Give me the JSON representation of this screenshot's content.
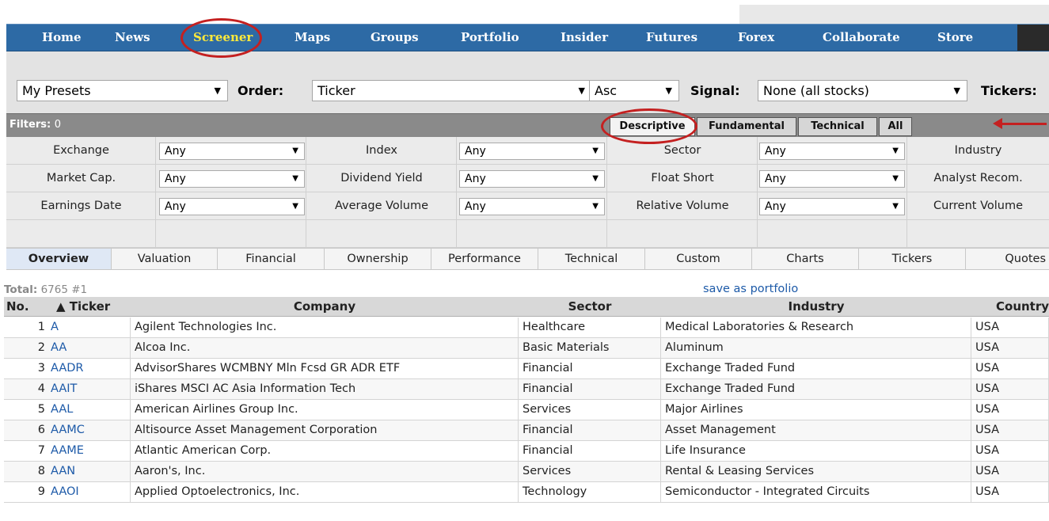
{
  "nav": {
    "items": [
      "Home",
      "News",
      "Screener",
      "Maps",
      "Groups",
      "Portfolio",
      "Insider",
      "Futures",
      "Forex",
      "Collaborate",
      "Store"
    ],
    "active": "Screener"
  },
  "toolbar": {
    "presets_value": "My Presets",
    "order_label": "Order:",
    "order_value": "Ticker",
    "direction_value": "Asc",
    "signal_label": "Signal:",
    "signal_value": "None (all stocks)",
    "tickers_label": "Tickers:"
  },
  "filters": {
    "label": "Filters:",
    "count": "0",
    "tabs": [
      "Descriptive",
      "Fundamental",
      "Technical",
      "All"
    ],
    "active_tab": "Descriptive",
    "rows": [
      [
        {
          "label": "Exchange",
          "value": "Any"
        },
        {
          "label": "Index",
          "value": "Any"
        },
        {
          "label": "Sector",
          "value": "Any"
        },
        {
          "label": "Industry",
          "value": ""
        }
      ],
      [
        {
          "label": "Market Cap.",
          "value": "Any"
        },
        {
          "label": "Dividend Yield",
          "value": "Any"
        },
        {
          "label": "Float Short",
          "value": "Any"
        },
        {
          "label": "Analyst Recom.",
          "value": ""
        }
      ],
      [
        {
          "label": "Earnings Date",
          "value": "Any"
        },
        {
          "label": "Average Volume",
          "value": "Any"
        },
        {
          "label": "Relative Volume",
          "value": "Any"
        },
        {
          "label": "Current Volume",
          "value": ""
        }
      ]
    ]
  },
  "view_tabs": [
    "Overview",
    "Valuation",
    "Financial",
    "Ownership",
    "Performance",
    "Technical",
    "Custom",
    "Charts",
    "Tickers",
    "Quotes"
  ],
  "active_view": "Overview",
  "total": {
    "label": "Total:",
    "value": "6765 #1"
  },
  "save_link": "save as portfolio",
  "table": {
    "headers": [
      "No.",
      "▲ Ticker",
      "Company",
      "Sector",
      "Industry",
      "Country"
    ],
    "rows": [
      [
        "1",
        "A",
        "Agilent Technologies Inc.",
        "Healthcare",
        "Medical Laboratories & Research",
        "USA"
      ],
      [
        "2",
        "AA",
        "Alcoa Inc.",
        "Basic Materials",
        "Aluminum",
        "USA"
      ],
      [
        "3",
        "AADR",
        "AdvisorShares WCMBNY Mln Fcsd GR ADR ETF",
        "Financial",
        "Exchange Traded Fund",
        "USA"
      ],
      [
        "4",
        "AAIT",
        "iShares MSCI AC Asia Information Tech",
        "Financial",
        "Exchange Traded Fund",
        "USA"
      ],
      [
        "5",
        "AAL",
        "American Airlines Group Inc.",
        "Services",
        "Major Airlines",
        "USA"
      ],
      [
        "6",
        "AAMC",
        "Altisource Asset Management Corporation",
        "Financial",
        "Asset Management",
        "USA"
      ],
      [
        "7",
        "AAME",
        "Atlantic American Corp.",
        "Financial",
        "Life Insurance",
        "USA"
      ],
      [
        "8",
        "AAN",
        "Aaron's, Inc.",
        "Services",
        "Rental & Leasing Services",
        "USA"
      ],
      [
        "9",
        "AAOI",
        "Applied Optoelectronics, Inc.",
        "Technology",
        "Semiconductor - Integrated Circuits",
        "USA"
      ]
    ]
  },
  "colors": {
    "nav_bg": "#2d6aa5",
    "nav_active": "#ffe93a",
    "annotation": "#c42020",
    "link": "#1d5aa8"
  }
}
